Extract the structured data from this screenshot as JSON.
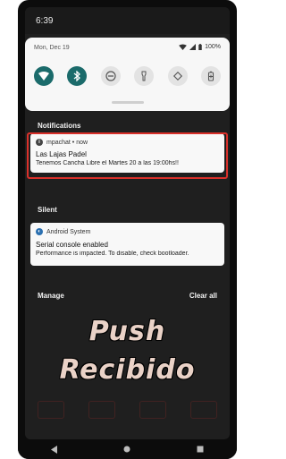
{
  "status_bar": {
    "time": "6:39"
  },
  "quick_settings": {
    "date": "Mon, Dec 19",
    "battery": "100%",
    "tiles": [
      {
        "icon": "wifi-icon",
        "state": "on"
      },
      {
        "icon": "bluetooth-icon",
        "state": "on"
      },
      {
        "icon": "do-not-disturb-icon",
        "state": "off"
      },
      {
        "icon": "flashlight-icon",
        "state": "off"
      },
      {
        "icon": "auto-rotate-icon",
        "state": "off"
      },
      {
        "icon": "battery-saver-icon",
        "state": "off"
      }
    ]
  },
  "notifications_header": "Notifications",
  "notification": {
    "app": "mpachat • now",
    "title": "Las Lajas Padel",
    "text": "Tenemos Cancha Libre el Martes 20 a las 19:00hs!!"
  },
  "silent_header": "Silent",
  "silent_notification": {
    "app": "Android System",
    "title": "Serial console enabled",
    "text": "Performance is impacted. To disable, check bootloader."
  },
  "footer": {
    "manage": "Manage",
    "clear_all": "Clear all"
  },
  "overlay": {
    "line1": "Push",
    "line2": "Recibido"
  },
  "colors": {
    "accent": "#1b6b6b",
    "highlight": "#d9302a"
  }
}
